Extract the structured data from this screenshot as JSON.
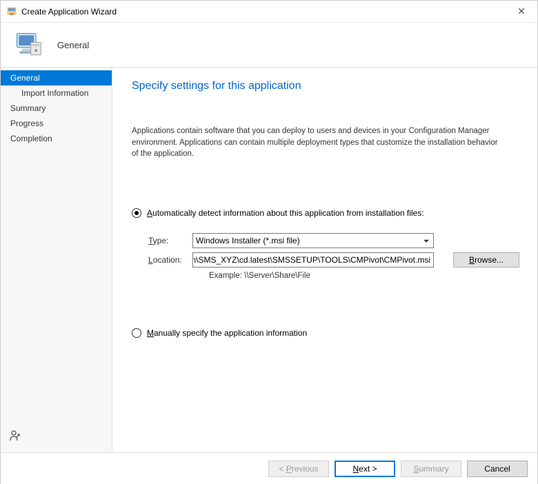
{
  "titlebar": {
    "title": "Create Application Wizard",
    "close_glyph": "✕"
  },
  "header": {
    "title": "General"
  },
  "sidebar": {
    "items": [
      {
        "label": "General",
        "selected": true,
        "sub": false
      },
      {
        "label": "Import Information",
        "selected": false,
        "sub": true
      },
      {
        "label": "Summary",
        "selected": false,
        "sub": false
      },
      {
        "label": "Progress",
        "selected": false,
        "sub": false
      },
      {
        "label": "Completion",
        "selected": false,
        "sub": false
      }
    ]
  },
  "main": {
    "heading": "Specify settings for this application",
    "description": "Applications contain software that you can deploy to users and devices in your Configuration Manager environment. Applications can contain multiple deployment types that customize the installation behavior of the application.",
    "radio1_prefix": "",
    "radio1_u": "A",
    "radio1_rest": "utomatically detect information about this application from installation files:",
    "type_label_u": "T",
    "type_label_rest": "ype:",
    "type_value": "Windows Installer (*.msi file)",
    "location_label_u": "L",
    "location_label_rest": "ocation:",
    "location_value": "o.com\\SMS_XYZ\\cd.latest\\SMSSETUP\\TOOLS\\CMPivot\\CMPivot.msi",
    "browse_u": "B",
    "browse_rest": "rowse...",
    "example_text": "Example: \\\\Server\\Share\\File",
    "radio2_u": "M",
    "radio2_rest": "anually specify the application information"
  },
  "footer": {
    "prev_lt": "< ",
    "prev_u": "P",
    "prev_rest": "revious",
    "next_u": "N",
    "next_rest": "ext >",
    "summary_u": "S",
    "summary_rest": "ummary",
    "cancel": "Cancel"
  }
}
